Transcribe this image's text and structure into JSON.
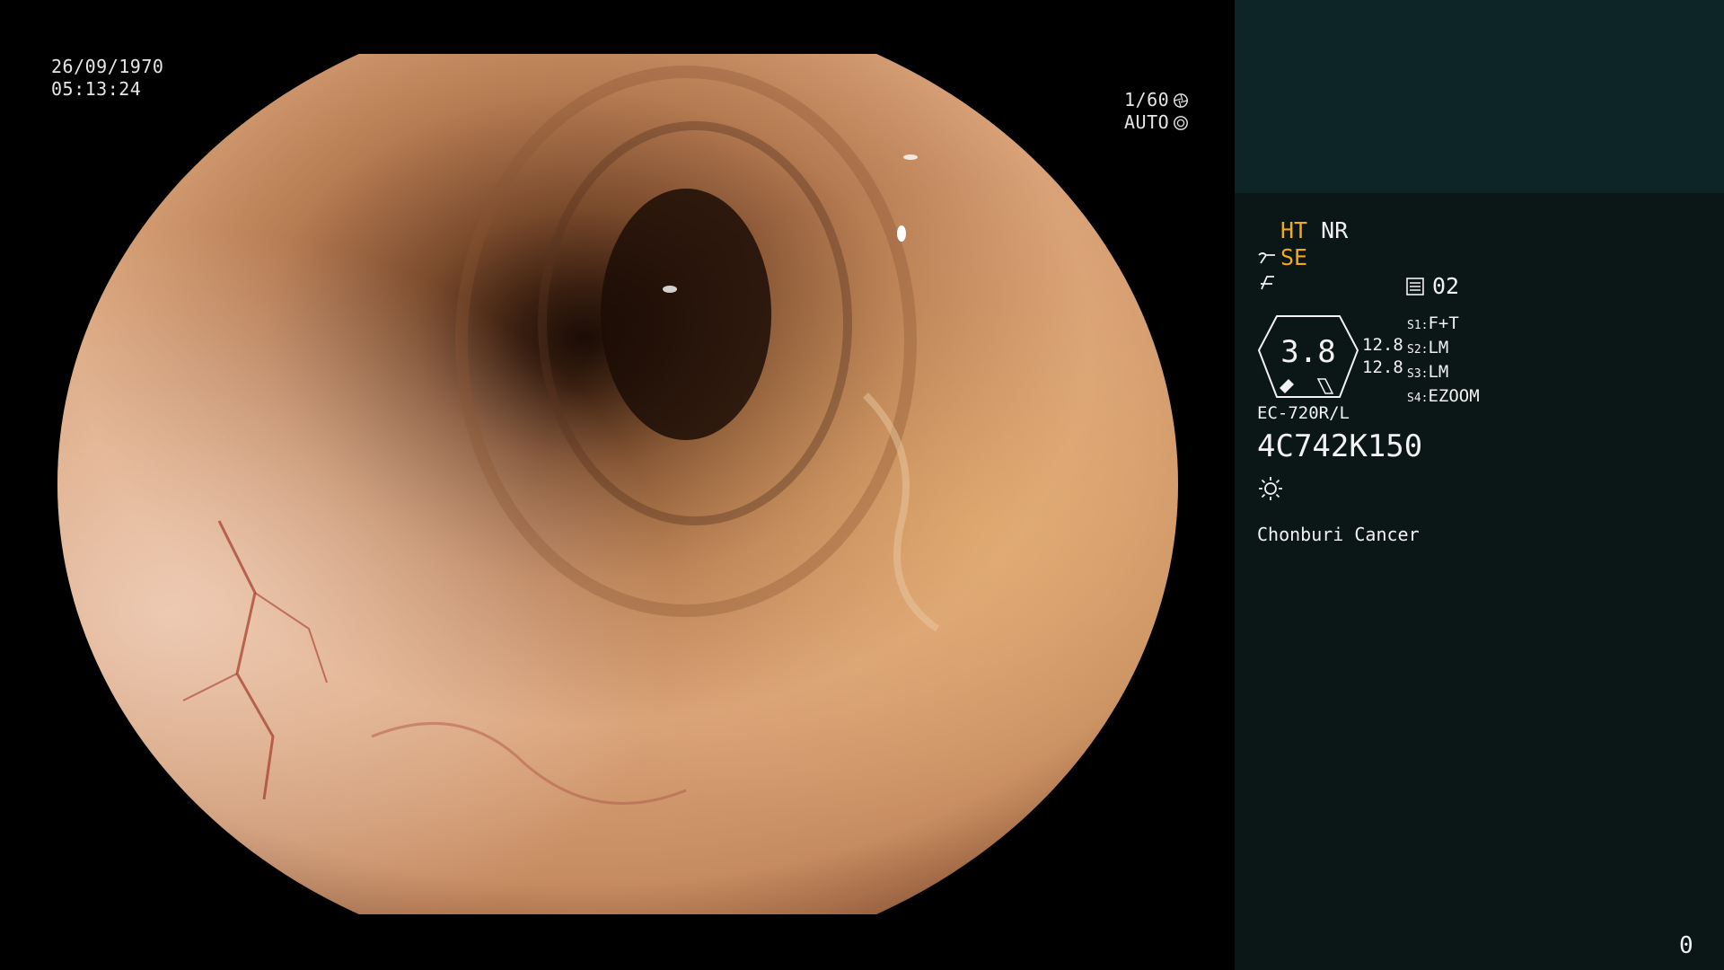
{
  "overlay": {
    "date": "26/09/1970",
    "time": "05:13:24",
    "shutter": "1/60",
    "iris": "AUTO"
  },
  "panel": {
    "mode_ht": "HT",
    "mode_nr": "NR",
    "mode_se": "SE",
    "preset_number": "02",
    "zoom_value": "3.8",
    "readout_1": "12.8",
    "readout_2": "12.8",
    "switches": [
      {
        "key": "S1:",
        "value": "F+T"
      },
      {
        "key": "S2:",
        "value": "LM"
      },
      {
        "key": "S3:",
        "value": "LM"
      },
      {
        "key": "S4:",
        "value": "EZOOM"
      }
    ],
    "scope_model": "EC-720R/L",
    "serial_number": "4C742K150",
    "facility": "Chonburi Cancer",
    "counter": "0"
  },
  "colors": {
    "accent": "#f2a91b",
    "panel_top": "#0d2526",
    "panel_bottom": "#0b1716"
  },
  "icons": [
    "shutter-icon",
    "iris-icon",
    "scope-angle-icon",
    "filter-icon",
    "preset-icon",
    "light-icon"
  ]
}
